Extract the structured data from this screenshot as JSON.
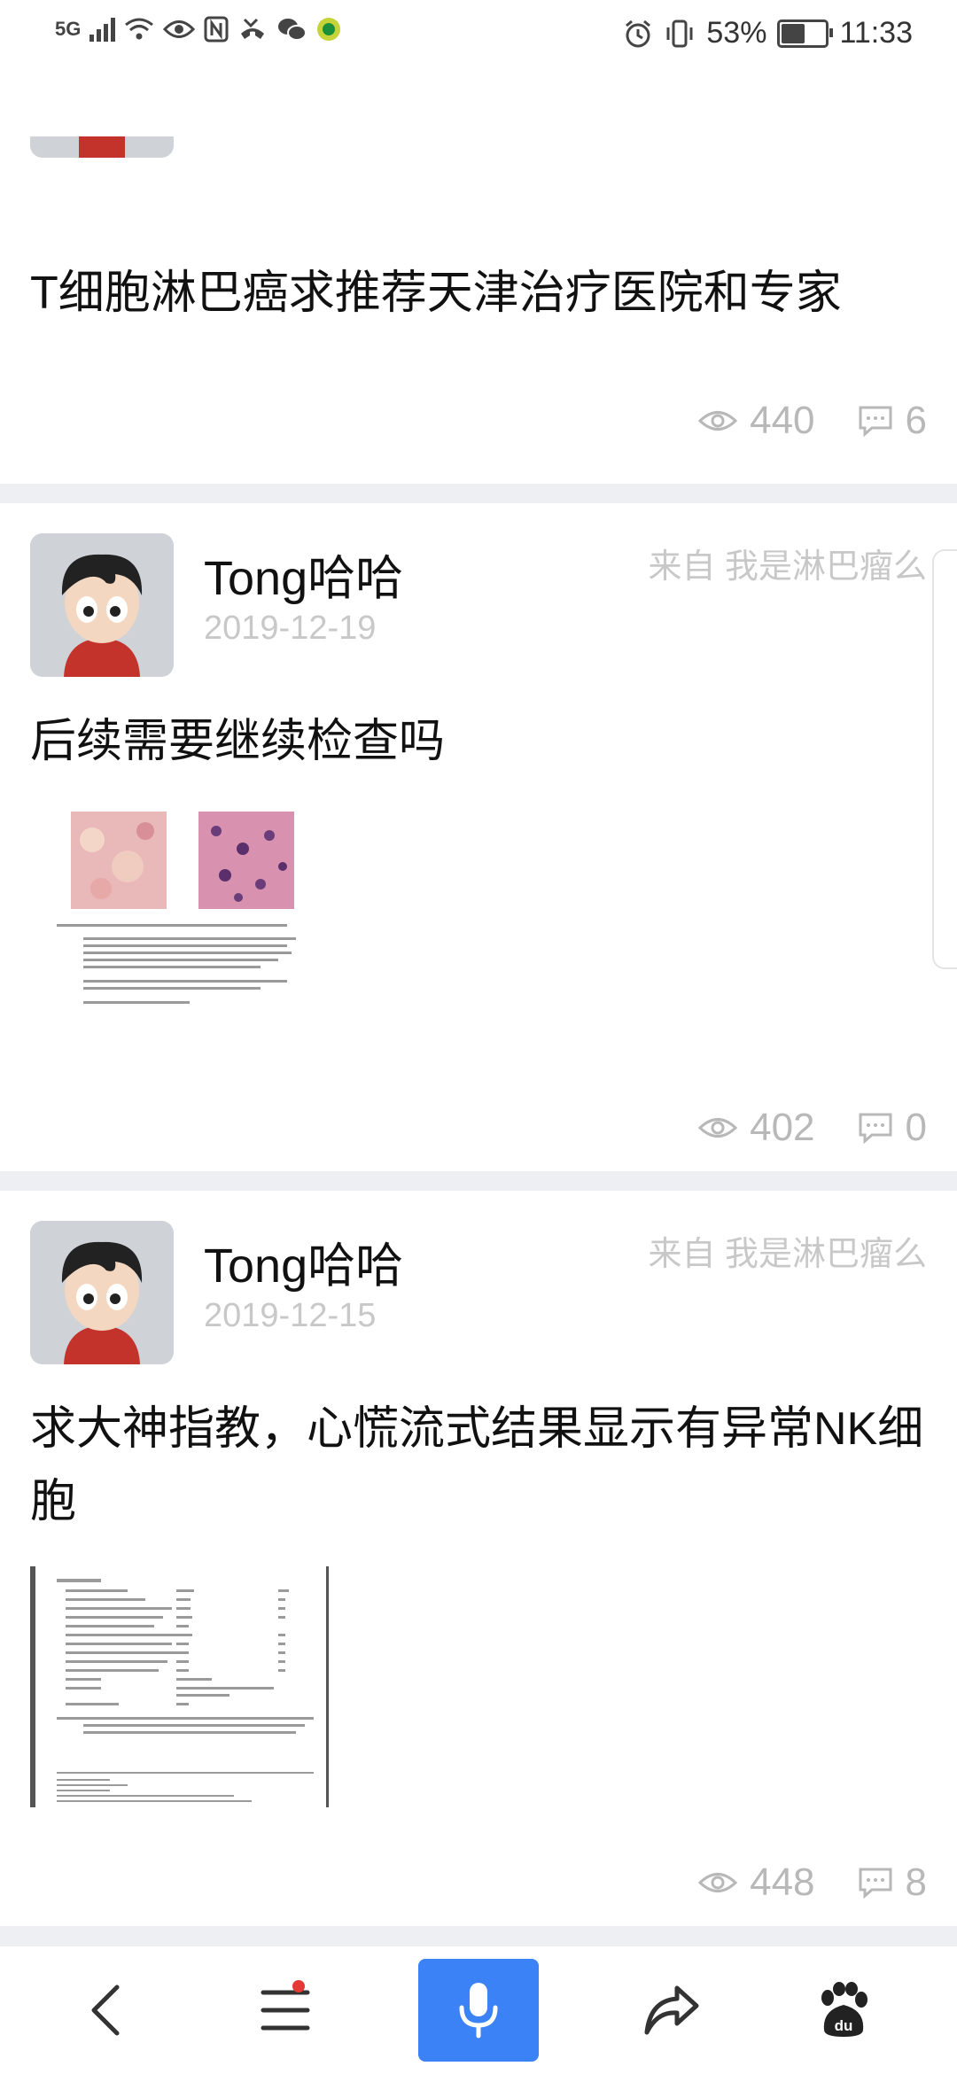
{
  "status_bar": {
    "network": "5G",
    "battery": "53%",
    "battery_level": 0.53,
    "time": "11:33"
  },
  "posts": [
    {
      "title": "T细胞淋巴癌求推荐天津治疗医院和专家",
      "views": "440",
      "comments": "6"
    },
    {
      "author": "Tong哈哈",
      "date": "2019-12-19",
      "source": "来自 我是淋巴瘤么",
      "title": "后续需要继续检查吗",
      "views": "402",
      "comments": "0"
    },
    {
      "author": "Tong哈哈",
      "date": "2019-12-15",
      "source": "来自 我是淋巴瘤么",
      "title": "求大神指教，心慌流式结果显示有异常NK细胞",
      "views": "448",
      "comments": "8"
    }
  ],
  "bottom_nav": {
    "items": [
      "back-icon",
      "menu-icon",
      "microphone-icon",
      "share-icon",
      "baidu-paw-icon"
    ],
    "accent": "#3b82f6"
  }
}
